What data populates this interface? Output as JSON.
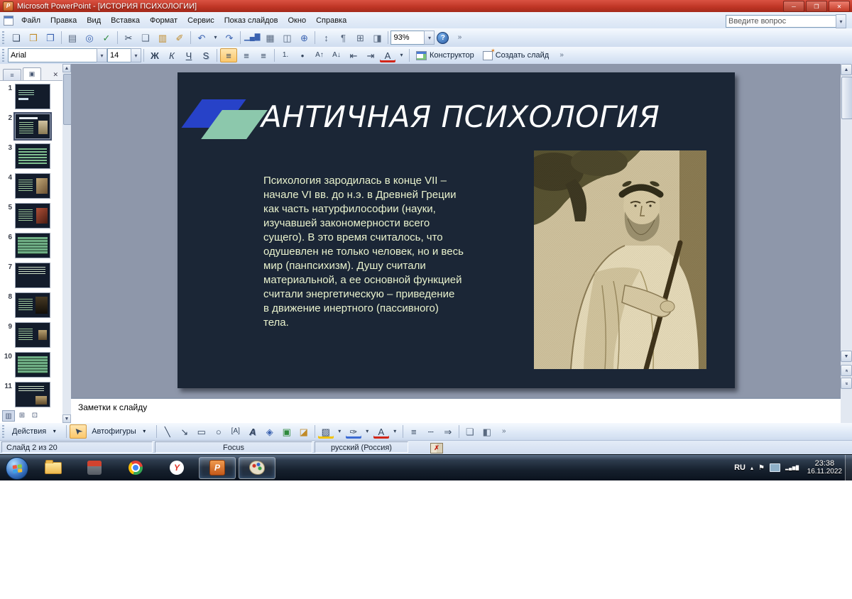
{
  "window": {
    "title": "Microsoft PowerPoint - [ИСТОРИЯ ПСИХОЛОГИИ]"
  },
  "menubar": {
    "items": [
      "Файл",
      "Правка",
      "Вид",
      "Вставка",
      "Формат",
      "Сервис",
      "Показ слайдов",
      "Окно",
      "Справка"
    ],
    "question_placeholder": "Введите вопрос"
  },
  "standard_toolbar": {
    "zoom": "93%"
  },
  "formatting_toolbar": {
    "font": "Arial",
    "size": "14",
    "designer": "Конструктор",
    "new_slide": "Создать слайд"
  },
  "slides_panel": {
    "slides": [
      {
        "num": "1",
        "variant": "title"
      },
      {
        "num": "2",
        "variant": "current"
      },
      {
        "num": "3",
        "variant": "bullets"
      },
      {
        "num": "4",
        "variant": "img-sepia"
      },
      {
        "num": "5",
        "variant": "img-red"
      },
      {
        "num": "6",
        "variant": "table"
      },
      {
        "num": "7",
        "variant": "text-top"
      },
      {
        "num": "8",
        "variant": "img-dark"
      },
      {
        "num": "9",
        "variant": "img-small"
      },
      {
        "num": "10",
        "variant": "table"
      },
      {
        "num": "11",
        "variant": "img-bottom"
      }
    ]
  },
  "slide": {
    "title": "АНТИЧНАЯ ПСИХОЛОГИЯ",
    "body": "Психология зародилась в конце VII –\nначале VI вв. до н.э. в Древней Греции\nкак часть натурфилософии (науки,\nизучавшей закономерности всего\nсущего). В это время считалось, что\nодушевлен не только человек, но и весь\nмир (панпсихизм). Душу считали\nматериальной, а ее основной функцией\nсчитали энергетическую – приведение\nв движение инертного (пассивного)\nтела."
  },
  "notes": {
    "placeholder": "Заметки к слайду"
  },
  "drawing_toolbar": {
    "actions": "Действия",
    "autoshapes": "Автофигуры"
  },
  "status_bar": {
    "slide_info": "Слайд 2 из 20",
    "design": "Focus",
    "language": "русский (Россия)"
  },
  "taskbar": {
    "lang": "RU",
    "time": "23:38",
    "date": "16.11.2022"
  },
  "icons": {
    "min": "─",
    "restore": "❐",
    "close": "✕",
    "new_document": "❏",
    "open": "❒",
    "save": "❐",
    "print": "▤",
    "print_preview": "◎",
    "spelling": "✓",
    "cut": "✂",
    "copy": "❑",
    "paste": "▥",
    "format_painter": "✐",
    "undo": "↶",
    "redo": "↷",
    "dropdown": "▾",
    "chart": "▁▄▇",
    "table": "▦",
    "tables_borders": "◫",
    "hyperlink": "⊕",
    "expand_all": "↕",
    "show_formatting": "¶",
    "grid": "⊞",
    "grayscale": "◨",
    "help": "?",
    "overflow": "»",
    "bold": "Ж",
    "italic": "К",
    "underline": "Ч",
    "shadow": "S",
    "align": "≡",
    "numbering": "1.",
    "bullets": "•",
    "font_up": "А↑",
    "font_down": "А↓",
    "outdent": "⇤",
    "indent": "⇥",
    "font_color": "А",
    "outline_tab": "≡",
    "slides_tab": "▣",
    "close_pane": "✕",
    "scroll_up": "▲",
    "scroll_down": "▼",
    "prev_slide": "«",
    "next_slide": "»",
    "view_normal": "▥",
    "view_sorter": "⊞",
    "view_show": "⊡",
    "select": "➤",
    "line": "╲",
    "arrow": "↘",
    "rectangle": "▭",
    "oval": "○",
    "text_box": "[А]",
    "wordart": "А",
    "diagram": "◈",
    "clipart": "▣",
    "picture": "◪",
    "fill_color": "▨",
    "line_color": "✑",
    "line_style": "≡",
    "dash_style": "┄",
    "arrow_style": "⇒",
    "shadow_style": "❏",
    "threed_style": "◧",
    "star": "✶",
    "flag": "⚑",
    "chevron_up": "▴",
    "signal": "▂▄▆█",
    "yandex_letter": "Y",
    "ppt_letter": "P",
    "spell_error": "✗"
  }
}
